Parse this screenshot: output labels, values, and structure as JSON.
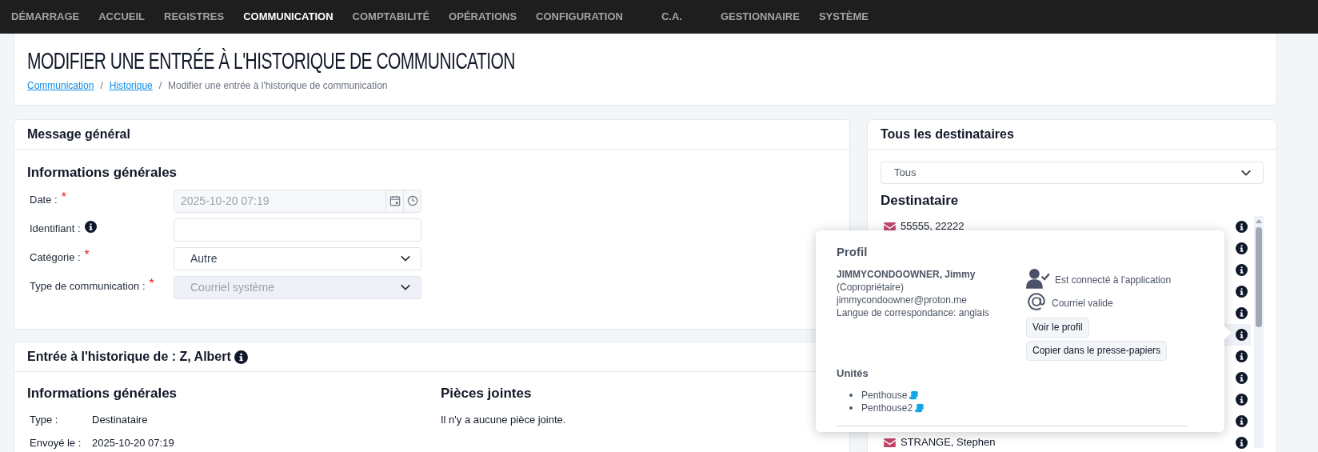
{
  "nav": [
    {
      "label": "DÉMARRAGE",
      "selected": false
    },
    {
      "label": "ACCUEIL",
      "selected": false
    },
    {
      "label": "REGISTRES",
      "selected": false
    },
    {
      "label": "COMMUNICATION",
      "selected": true
    },
    {
      "label": "COMPTABILITÉ",
      "selected": false
    },
    {
      "label": "OPÉRATIONS",
      "selected": false
    },
    {
      "label": "CONFIGURATION",
      "selected": false
    },
    {
      "label": "C.A.",
      "selected": false
    },
    {
      "label": "GESTIONNAIRE",
      "selected": false
    },
    {
      "label": "SYSTÈME",
      "selected": false
    }
  ],
  "header": {
    "title": "MODIFIER UNE ENTRÉE À L'HISTORIQUE DE COMMUNICATION",
    "separator": "/",
    "breadcrumb": [
      {
        "label": "Communication",
        "kind": "link"
      },
      {
        "label": "Historique",
        "kind": "link"
      },
      {
        "label": "Modifier une entrée à l'historique de communication",
        "kind": "current"
      }
    ]
  },
  "general_card": {
    "title": "Message général",
    "section_title": "Informations générales",
    "required_mark": "*",
    "fields": [
      {
        "label": "Date :",
        "required": true,
        "info": false,
        "kind": "datetime",
        "value": "2025-10-20 07:19",
        "disabled": true
      },
      {
        "label": "Identifiant :",
        "required": false,
        "info": true,
        "kind": "text",
        "disabled": false
      },
      {
        "label": "Catégorie :",
        "required": true,
        "info": false,
        "kind": "select",
        "value": "Autre",
        "disabled": false
      },
      {
        "label": "Type de communication :",
        "required": true,
        "info": false,
        "kind": "select",
        "value": "Courriel système",
        "disabled": true
      }
    ]
  },
  "history_card": {
    "title": "Entrée à l'historique de : Z, Albert",
    "info": true,
    "section_title": "Informations générales",
    "details": [
      {
        "label": "Type :",
        "value": "Destinataire"
      },
      {
        "label": "Envoyé le :",
        "value": "2025-10-20 07:19"
      }
    ],
    "attachments_title": "Pièces jointes",
    "attachments_text": "Il n'y a aucune pièce jointe."
  },
  "recipients_card": {
    "title": "Tous les destinataires",
    "filter": "Tous",
    "list_title": "Destinataire",
    "recipients": [
      {
        "name": "55555, 22222",
        "selected": false
      },
      {
        "selected": false
      },
      {
        "selected": false
      },
      {
        "selected": false
      },
      {
        "selected": false
      },
      {
        "selected": true
      },
      {
        "selected": false
      },
      {
        "selected": false
      },
      {
        "selected": false
      },
      {
        "selected": false
      },
      {
        "name": "STRANGE, Stephen",
        "selected": false
      }
    ]
  },
  "popover": {
    "title": "Profil",
    "name": "JIMMYCONDOOWNER, Jimmy",
    "role": "(Copropriétaire)",
    "email": "jimmycondoowner@proton.me",
    "language": "Langue de correspondance: anglais",
    "statuses": [
      {
        "kind": "connected",
        "label": "Est connecté à l'application"
      },
      {
        "kind": "email",
        "label": "Courriel valide"
      }
    ],
    "buttons": [
      "Voir le profil",
      "Copier dans le presse-papiers"
    ],
    "units_title": "Unités",
    "units": [
      "Penthouse",
      "Penthouse2"
    ]
  }
}
